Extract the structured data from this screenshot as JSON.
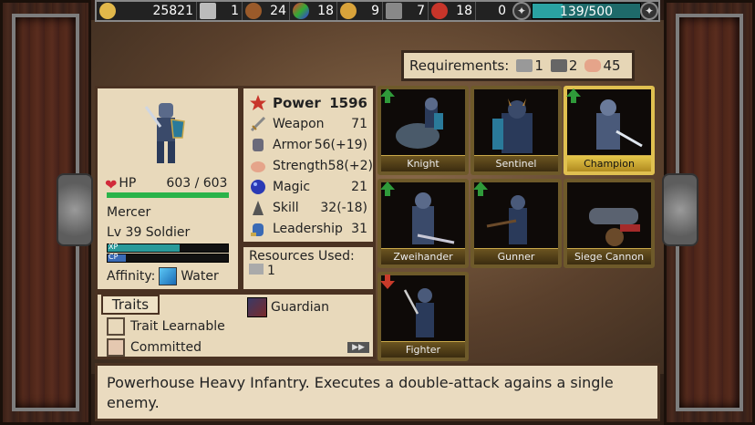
{
  "topbar": {
    "gold": "25821",
    "hammer": "1",
    "horse": "24",
    "gems": "18",
    "coin": "9",
    "ore": "7",
    "meat": "18",
    "misc": "0",
    "progress_text": "139/500",
    "progress_fraction": 0.278
  },
  "requirements": {
    "label": "Requirements:",
    "items": [
      "1",
      "2",
      "45"
    ]
  },
  "unit_info": {
    "hp_label": "HP",
    "hp_value": "603 / 603",
    "name": "Mercer",
    "level": "Lv 39 Soldier",
    "xp_label": "XP",
    "cp_label": "CP",
    "xp_fraction": 0.6,
    "cp_fraction": 0.15,
    "affinity_label": "Affinity:",
    "affinity_value": "Water"
  },
  "stats": [
    {
      "name": "Power",
      "value": "1596"
    },
    {
      "name": "Weapon",
      "value": "71"
    },
    {
      "name": "Armor",
      "value": "56(+19)"
    },
    {
      "name": "Strength",
      "value": "58(+2)"
    },
    {
      "name": "Magic",
      "value": "21"
    },
    {
      "name": "Skill",
      "value": "32(-18)"
    },
    {
      "name": "Leadership",
      "value": "31"
    }
  ],
  "resources": {
    "label": "Resources Used:",
    "value": "1"
  },
  "traits": {
    "header": "Traits",
    "items": [
      "Trait Learnable",
      "Committed",
      "Guardian"
    ]
  },
  "units": [
    "Knight",
    "Sentinel",
    "Champion",
    "Zweihander",
    "Gunner",
    "Siege Cannon",
    "Fighter"
  ],
  "colors": {
    "accent": "#e0c050",
    "hp": "#2ab34a",
    "xp": "#2aa2a2",
    "up_arrow": "#2f9a3a",
    "down_arrow": "#c83a2a"
  },
  "description": "Powerhouse Heavy Infantry. Executes a double-attack agains a single enemy."
}
